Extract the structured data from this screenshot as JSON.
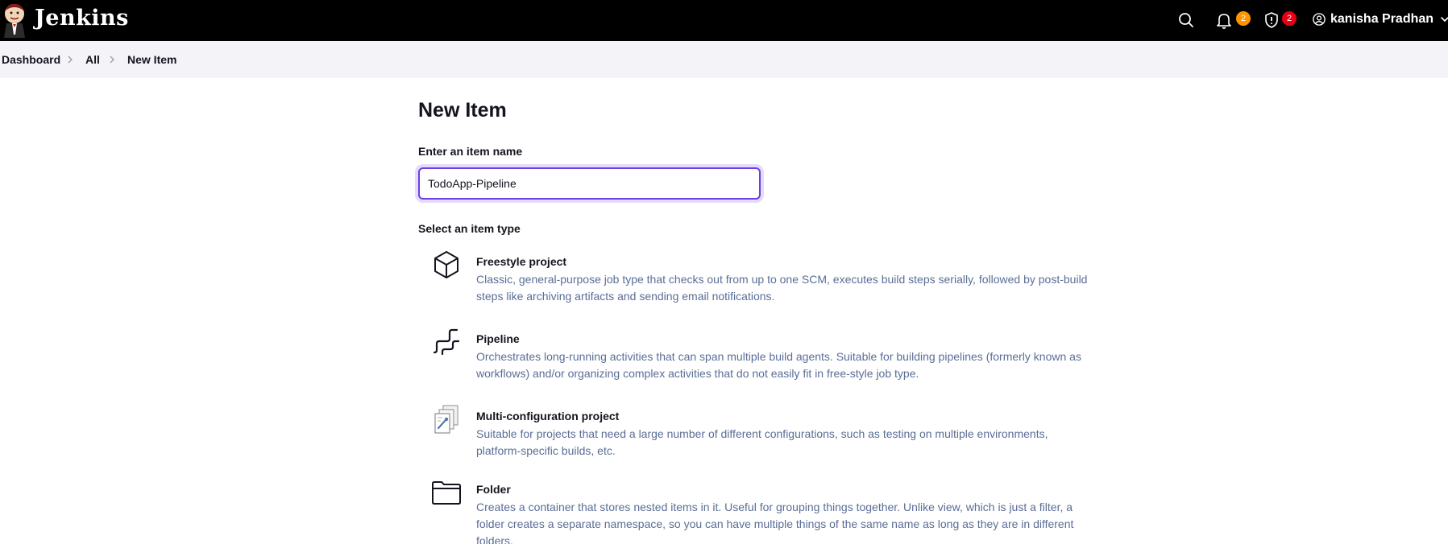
{
  "header": {
    "brand": "Jenkins",
    "logo_icon": "jenkins-butler-logo",
    "search_icon": "search-icon",
    "notifications": {
      "icon": "bell-icon",
      "count": "2",
      "color": "#ff9500"
    },
    "security": {
      "icon": "shield-icon",
      "count": "2",
      "color": "#e60013"
    },
    "user": {
      "name": "kanisha Pradhan",
      "icon": "user-circle-icon",
      "menu_icon": "chevron-down-icon"
    }
  },
  "breadcrumb": {
    "items": [
      "Dashboard",
      "All",
      "New Item"
    ],
    "separator_icon": "chevron-right-icon"
  },
  "main": {
    "title": "New Item",
    "name_label": "Enter an item name",
    "name_value": "TodoApp-Pipeline",
    "type_label": "Select an item type",
    "item_types": [
      {
        "name": "Freestyle project",
        "icon": "cube-icon",
        "description": "Classic, general-purpose job type that checks out from up to one SCM, executes build steps serially, followed by post-build steps like archiving artifacts and sending email notifications."
      },
      {
        "name": "Pipeline",
        "icon": "pipeline-icon",
        "description": "Orchestrates long-running activities that can span multiple build agents. Suitable for building pipelines (formerly known as workflows) and/or organizing complex activities that do not easily fit in free-style job type."
      },
      {
        "name": "Multi-configuration project",
        "icon": "multi-config-icon",
        "description": "Suitable for projects that need a large number of different configurations, such as testing on multiple environments, platform-specific builds, etc."
      },
      {
        "name": "Folder",
        "icon": "folder-icon",
        "description": "Creates a container that stores nested items in it. Useful for grouping things together. Unlike view, which is just a filter, a folder creates a separate namespace, so you can have multiple things of the same name as long as they are in different folders."
      }
    ]
  },
  "colors": {
    "header_bg": "#000000",
    "breadcrumb_bg": "#f4f4f8",
    "input_focus": "#6d3ee6",
    "description_text": "#5a6e96"
  }
}
